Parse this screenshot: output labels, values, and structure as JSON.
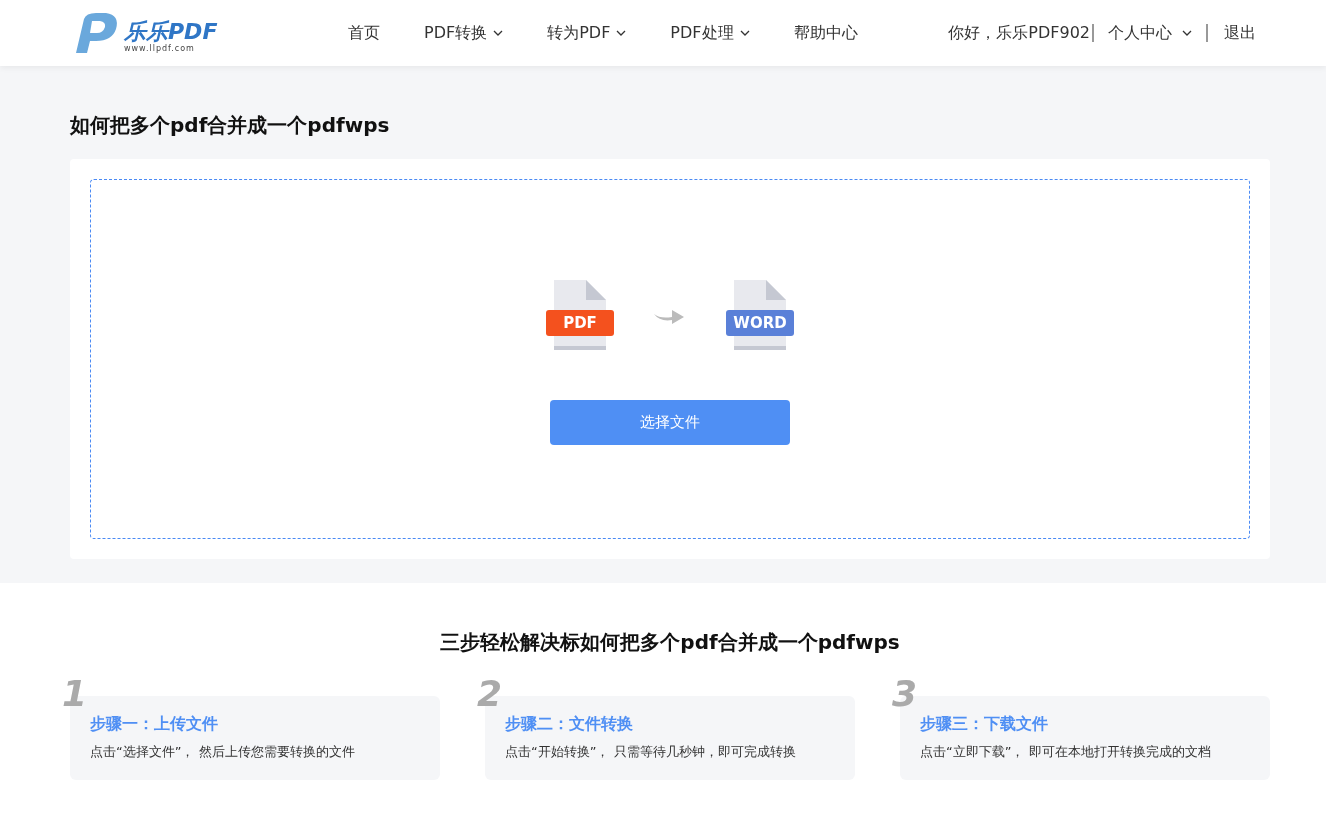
{
  "header": {
    "logo": {
      "name": "乐乐PDF",
      "url": "www.llpdf.com"
    },
    "nav": [
      {
        "label": "首页",
        "dropdown": false
      },
      {
        "label": "PDF转换",
        "dropdown": true
      },
      {
        "label": "转为PDF",
        "dropdown": true
      },
      {
        "label": "PDF处理",
        "dropdown": true
      },
      {
        "label": "帮助中心",
        "dropdown": false
      }
    ],
    "greeting": "你好，乐乐PDF902",
    "user_menu": "个人中心",
    "logout": "退出"
  },
  "page_title": "如何把多个pdf合并成一个pdfwps",
  "upload": {
    "from_label": "PDF",
    "to_label": "WORD",
    "button": "选择文件"
  },
  "steps_title": "三步轻松解决标如何把多个pdf合并成一个pdfwps",
  "steps": [
    {
      "number": "1",
      "title": "步骤一：上传文件",
      "text": "点击“选择文件”， 然后上传您需要转换的文件"
    },
    {
      "number": "2",
      "title": "步骤二：文件转换",
      "text": "点击“开始转换”， 只需等待几秒钟，即可完成转换"
    },
    {
      "number": "3",
      "title": "步骤三：下载文件",
      "text": "点击“立即下载”， 即可在本地打开转换完成的文档"
    }
  ]
}
